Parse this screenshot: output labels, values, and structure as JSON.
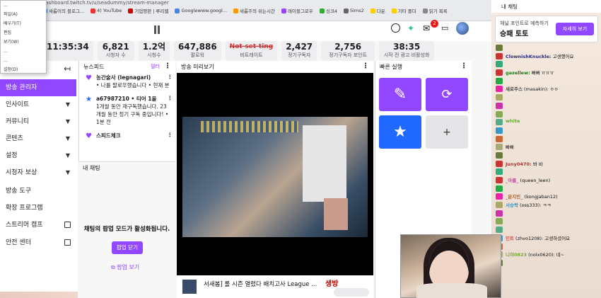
{
  "browser": {
    "url": "dashboard.twitch.tv/u/seadummy/stream-manager",
    "bookmarks": [
      "새롭이의 블로그...",
      "4) YouTube",
      "기업평판 | 루리웹",
      "Googlewww.googl...",
      "새롭주의 쉬는시간",
      "레이블그로우",
      "싱크4",
      "Sims2",
      "다운",
      "기타 폴더",
      "읽기 목록"
    ]
  },
  "menu": {
    "items": [
      "…",
      "파일(A)",
      "배우기(T)",
      "편집",
      "보기(W)",
      "…",
      "…",
      "설정(D)"
    ]
  },
  "topbar": {
    "notifications_count": "2"
  },
  "stats": [
    {
      "value": "11:35:34",
      "label": ""
    },
    {
      "value": "6,821",
      "label": "시청자 수"
    },
    {
      "value": "1.2억",
      "label": "시청수"
    },
    {
      "value": "647,886",
      "label": "팔로워"
    },
    {
      "value": "Not-set-ting",
      "label": "비트레이트",
      "strike": true
    },
    {
      "value": "2,427",
      "label": "정기구독자"
    },
    {
      "value": "2,756",
      "label": "정기구독자 포인트"
    },
    {
      "value": "38:35",
      "label": "시작 전 광고 비활성화"
    }
  ],
  "nav": {
    "items": [
      {
        "label": "방송 관리자",
        "active": true
      },
      {
        "label": "인사이트",
        "chevron": true
      },
      {
        "label": "커뮤니티",
        "chevron": true
      },
      {
        "label": "콘텐츠",
        "chevron": true
      },
      {
        "label": "설정",
        "chevron": true
      },
      {
        "label": "시청자 보상",
        "chevron": true
      },
      {
        "label": "방송 도구"
      },
      {
        "label": "확장 프로그램"
      },
      {
        "label": "스트리머 캠프",
        "external": true
      },
      {
        "label": "안전 센터",
        "external": true
      }
    ]
  },
  "newsfeed": {
    "title": "뉴스피드",
    "filter_label": "필터",
    "items": [
      {
        "icon": "heart",
        "title": "농간술사 (legnagari)",
        "body": "• 나를 팔로우했습니다 • 현재 분"
      },
      {
        "icon": "star",
        "title": "a67987210 • 티어 1을",
        "body": "1개월 동안 재구독했습니다. 23개월 동안 정기 구독 중입니다! • 1분 전"
      },
      {
        "icon": "heart",
        "title": "스피드체크",
        "body": ""
      }
    ]
  },
  "mychat_left": {
    "title": "내 채팅",
    "message": "채팅의 팝업 모드가 활성화됩니다.",
    "close_label": "팝업 닫기",
    "view_label": "팝업 보기"
  },
  "preview": {
    "title": "방송 미리보기",
    "stream_title": "서새봄] 롤 시즌 열렸다 배치고사 League ...",
    "live_label": "생방"
  },
  "quick_actions": {
    "title": "빠른 실행"
  },
  "right_chat": {
    "title": "내 채팅",
    "promo": {
      "caption": "채널 포인트로 예측하기",
      "title": "승패 토토",
      "button": "자세히 보기"
    },
    "lines": [
      {
        "user": "",
        "text": ""
      },
      {
        "user": "ClownishKnuckle:",
        "text": "고생했어요",
        "color": "#2a2a7a"
      },
      {
        "user": "",
        "text": ""
      },
      {
        "user": "gazellew:",
        "text": "빠빠 ㅠㅠㅠ",
        "color": "#1a7a1a"
      },
      {
        "user": "",
        "text": ""
      },
      {
        "user": "새로주스",
        "text": "(masakin): ㅇㅇ",
        "color": "#444"
      },
      {
        "user": "",
        "text": ""
      },
      {
        "user": "",
        "text": ""
      },
      {
        "user": "",
        "text": ""
      },
      {
        "user": "white",
        "text": "",
        "color": "#6a3"
      },
      {
        "user": "",
        "text": ""
      },
      {
        "user": "",
        "text": ""
      },
      {
        "user": "",
        "text": "빠빠"
      },
      {
        "user": "",
        "text": ""
      },
      {
        "user": "Juny0470:",
        "text": "봐 바",
        "color": "#a33"
      },
      {
        "user": "",
        "text": ""
      },
      {
        "user": "_아름_",
        "text": "(queen_leen)",
        "color": "#c4a"
      },
      {
        "user": "",
        "text": ""
      },
      {
        "user": "_윤지빈_",
        "text": "(kongjaban12)",
        "color": "#a63"
      },
      {
        "user": "서승락",
        "text": "(oss333): ㅋㅋ",
        "color": "#39c"
      },
      {
        "user": "",
        "text": ""
      },
      {
        "user": "",
        "text": ""
      },
      {
        "user": "",
        "text": ""
      },
      {
        "user": "민트",
        "text": "(zhvo1208): 고생하셨어요",
        "color": "#c55"
      },
      {
        "user": "",
        "text": ""
      },
      {
        "user": "니야0823",
        "text": "(nolx0620): 네~",
        "color": "#7a3"
      },
      {
        "user": "",
        "text": ""
      }
    ]
  },
  "colors": {
    "accent": "#9147ff",
    "badge": "#e91916"
  }
}
